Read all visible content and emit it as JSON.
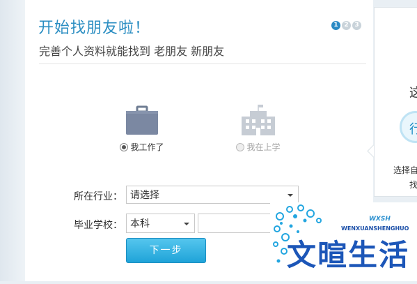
{
  "header": {
    "title": "开始找朋友啦！",
    "subtitle": "完善个人资料就能找到 老朋友 新朋友"
  },
  "steps": [
    "1",
    "2",
    "3"
  ],
  "options": {
    "work_label": "我工作了",
    "school_label": "我在上学"
  },
  "form": {
    "industry_label": "所在行业：",
    "industry_value": "请选择",
    "school_label": "毕业学校：",
    "degree_value": "本科",
    "school_input_value": ""
  },
  "next_button": "下一步",
  "side_panel": {
    "title": "这",
    "circle_text": "行",
    "line1": "选择自",
    "line2": "找"
  },
  "watermark": {
    "brand": "文暄生活",
    "pinyin": "WENXUANSHENGHUO",
    "initials": "WXSH"
  },
  "colors": {
    "title": "#2b8ec2",
    "active_step": "#2a8ac4",
    "button": "#1fa3d8"
  }
}
